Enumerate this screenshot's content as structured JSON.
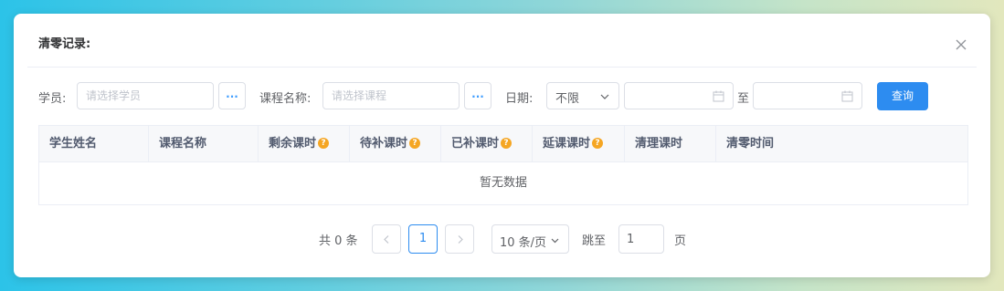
{
  "dialog": {
    "title": "清零记录:"
  },
  "filters": {
    "student_label": "学员:",
    "student_placeholder": "请选择学员",
    "student_pick": "...",
    "course_label": "课程名称:",
    "course_placeholder": "请选择课程",
    "course_pick": "...",
    "date_label": "日期:",
    "date_mode": "不限",
    "date_to": "至",
    "query_button": "查询"
  },
  "table": {
    "columns": [
      {
        "label": "学生姓名",
        "help": false
      },
      {
        "label": "课程名称",
        "help": false
      },
      {
        "label": "剩余课时",
        "help": true
      },
      {
        "label": "待补课时",
        "help": true
      },
      {
        "label": "已补课时",
        "help": true
      },
      {
        "label": "延课课时",
        "help": true
      },
      {
        "label": "清理课时",
        "help": false
      },
      {
        "label": "清零时间",
        "help": false
      }
    ],
    "help_glyph": "?",
    "empty_text": "暂无数据"
  },
  "pagination": {
    "total_text": "共 0 条",
    "current_page": "1",
    "page_size": "10 条/页",
    "jump_label": "跳至",
    "jump_value": "1",
    "page_suffix": "页"
  },
  "colors": {
    "primary": "#2d8cf0",
    "help_icon": "#f5a623"
  }
}
